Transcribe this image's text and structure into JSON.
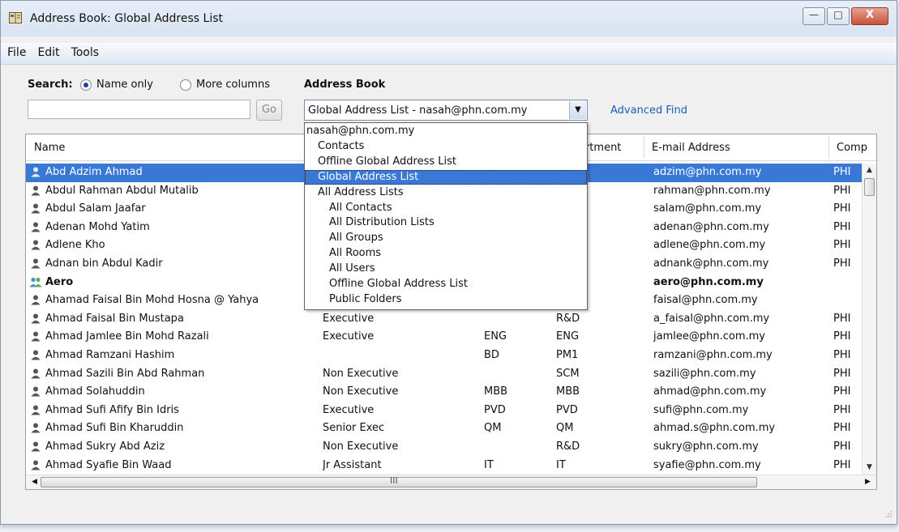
{
  "window": {
    "title": "Address Book: Global Address List"
  },
  "menu": [
    "File",
    "Edit",
    "Tools"
  ],
  "search": {
    "label": "Search:",
    "options": [
      {
        "label": "Name only",
        "checked": true
      },
      {
        "label": "More columns",
        "checked": false
      }
    ],
    "input_value": "",
    "go_label": "Go"
  },
  "address_book": {
    "label": "Address Book",
    "selected": "Global Address List - nasah@phn.com.my",
    "advanced_find": "Advanced Find",
    "dropdown": [
      {
        "label": "nasah@phn.com.my",
        "level": 0
      },
      {
        "label": "Contacts",
        "level": 1
      },
      {
        "label": "Offline Global Address List",
        "level": 1
      },
      {
        "label": "Global Address List",
        "level": 1,
        "selected": true
      },
      {
        "label": "All Address Lists",
        "level": 1
      },
      {
        "label": "All Contacts",
        "level": 2
      },
      {
        "label": "All Distribution Lists",
        "level": 2
      },
      {
        "label": "All Groups",
        "level": 2
      },
      {
        "label": "All Rooms",
        "level": 2
      },
      {
        "label": "All Users",
        "level": 2
      },
      {
        "label": "Offline Global Address List",
        "level": 2
      },
      {
        "label": "Public Folders",
        "level": 2
      }
    ]
  },
  "table": {
    "columns": [
      "Name",
      "artment",
      "E-mail Address",
      "Comp"
    ],
    "rows": [
      {
        "name": "Abd Adzim Ahmad",
        "title": "",
        "office": "",
        "dept": "",
        "email": "adzim@phn.com.my",
        "comp": "PHI",
        "selected": true
      },
      {
        "name": "Abdul Rahman Abdul Mutalib",
        "title": "",
        "office": "",
        "dept": "",
        "email": "rahman@phn.com.my",
        "comp": "PHI"
      },
      {
        "name": "Abdul Salam Jaafar",
        "title": "",
        "office": "",
        "dept": "",
        "email": "salam@phn.com.my",
        "comp": "PHI"
      },
      {
        "name": "Adenan Mohd Yatim",
        "title": "",
        "office": "",
        "dept": "",
        "email": "adenan@phn.com.my",
        "comp": "PHI"
      },
      {
        "name": "Adlene Kho",
        "title": "",
        "office": "",
        "dept": "",
        "email": "adlene@phn.com.my",
        "comp": "PHI"
      },
      {
        "name": "Adnan bin Abdul Kadir",
        "title": "",
        "office": "",
        "dept": "",
        "email": "adnank@phn.com.my",
        "comp": "PHI"
      },
      {
        "name": "Aero",
        "title": "",
        "office": "",
        "dept": "",
        "email": "aero@phn.com.my",
        "comp": "",
        "group": true
      },
      {
        "name": "Ahamad Faisal Bin Mohd Hosna @ Yahya",
        "title": "",
        "office": "",
        "dept": "",
        "email": "faisal@phn.com.my",
        "comp": ""
      },
      {
        "name": "Ahmad Faisal Bin Mustapa",
        "title": "Executive",
        "office": "",
        "dept": "R&D",
        "email": "a_faisal@phn.com.my",
        "comp": "PHI"
      },
      {
        "name": "Ahmad Jamlee Bin Mohd Razali",
        "title": "Executive",
        "office": "ENG",
        "dept": "ENG",
        "email": "jamlee@phn.com.my",
        "comp": "PHI"
      },
      {
        "name": "Ahmad Ramzani Hashim",
        "title": "",
        "office": "BD",
        "dept": "PM1",
        "email": "ramzani@phn.com.my",
        "comp": "PHI"
      },
      {
        "name": "Ahmad Sazili Bin Abd Rahman",
        "title": "Non Executive",
        "office": "",
        "dept": "SCM",
        "email": "sazili@phn.com.my",
        "comp": "PHI"
      },
      {
        "name": "Ahmad Solahuddin",
        "title": "Non Executive",
        "office": "MBB",
        "dept": "MBB",
        "email": "ahmad@phn.com.my",
        "comp": "PHI"
      },
      {
        "name": "Ahmad Sufi Afify Bin Idris",
        "title": "Executive",
        "office": "PVD",
        "dept": "PVD",
        "email": "sufi@phn.com.my",
        "comp": "PHI"
      },
      {
        "name": "Ahmad Sufi Bin Kharuddin",
        "title": "Senior Exec",
        "office": "QM",
        "dept": "QM",
        "email": "ahmad.s@phn.com.my",
        "comp": "PHI"
      },
      {
        "name": "Ahmad Sukry Abd Aziz",
        "title": "Non Executive",
        "office": "",
        "dept": "R&D",
        "email": "sukry@phn.com.my",
        "comp": "PHI"
      },
      {
        "name": "Ahmad Syafie Bin Waad",
        "title": "Jr Assistant",
        "office": "IT",
        "dept": "IT",
        "email": "syafie@phn.com.my",
        "comp": "PHI"
      }
    ]
  },
  "hscroll_grip": "III",
  "colors": {
    "selection": "#3a78d6",
    "link": "#1a5fb4",
    "close_button": "#c8523a"
  }
}
